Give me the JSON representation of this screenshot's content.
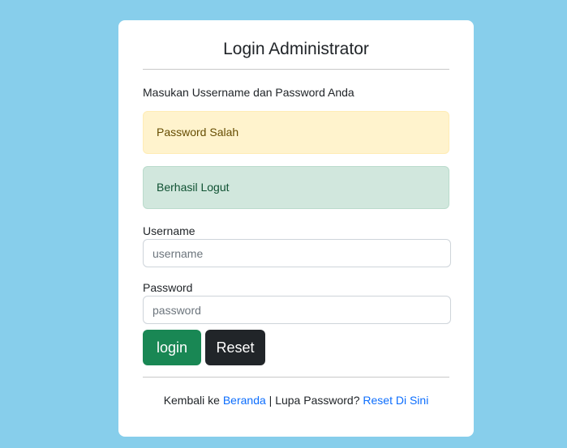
{
  "login_card": {
    "title": "Login Administrator",
    "intro": "Masukan Ussername dan Password Anda",
    "alerts": {
      "warning": "Password Salah",
      "success": "Berhasil Logut"
    },
    "username": {
      "label": "Username",
      "placeholder": "username",
      "value": ""
    },
    "password": {
      "label": "Password",
      "placeholder": "password",
      "value": ""
    },
    "buttons": {
      "login": "login",
      "reset": "Reset"
    },
    "footer": {
      "prefix": "Kembali ke ",
      "home_link": "Beranda",
      "separator": " | Lupa Password? ",
      "reset_link": "Reset Di Sini"
    }
  },
  "colors": {
    "page_background": "#87ceeb",
    "warning_background": "#fff3cd",
    "success_background": "#d1e7dd",
    "login_button": "#198754",
    "reset_button": "#212529",
    "link": "#0d6efd"
  }
}
